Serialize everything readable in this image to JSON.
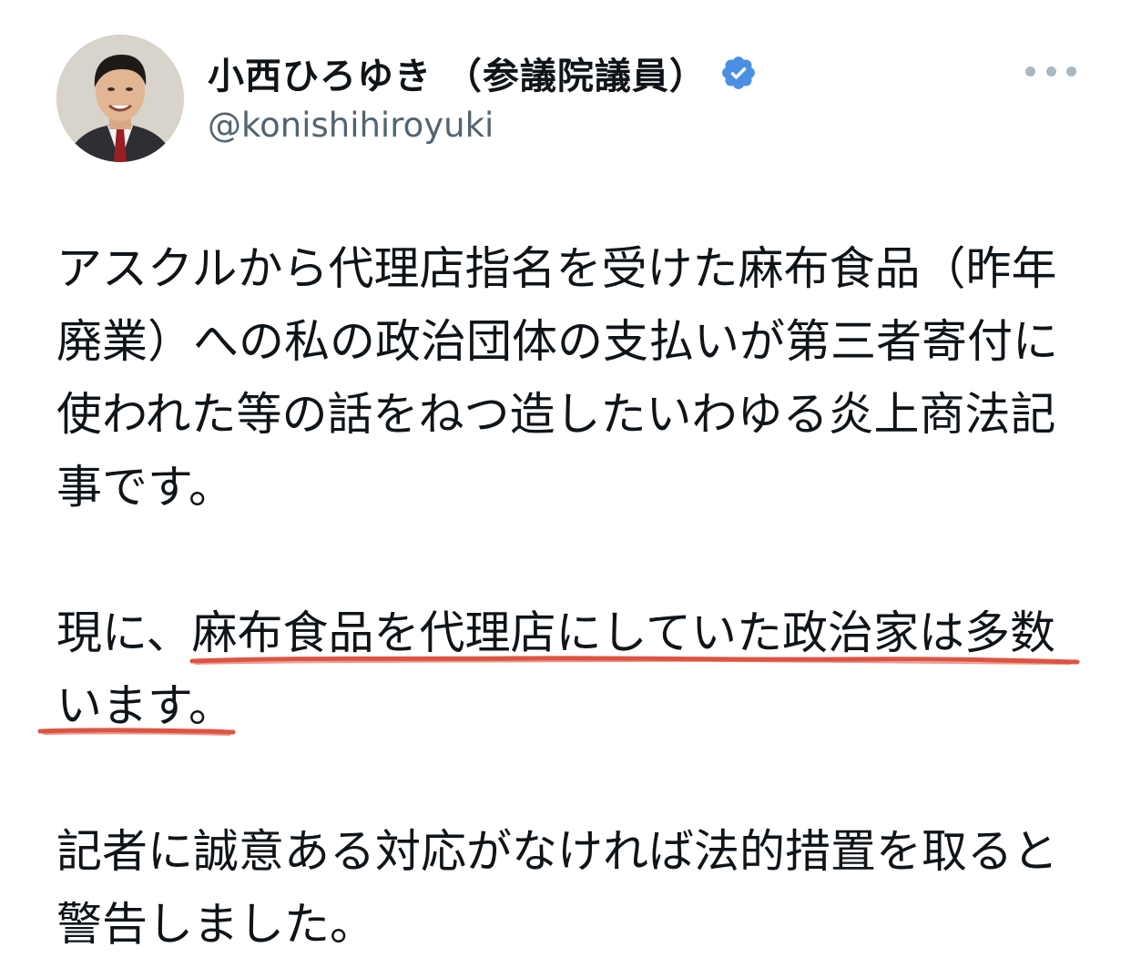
{
  "tweet": {
    "author": {
      "display_name": "小西ひろゆき （参議院議員）",
      "handle": "@konishihiroyuki",
      "verified_icon": "verified-badge-icon",
      "avatar": "avatar"
    },
    "more_icon": "more-dots-icon",
    "paragraph1": {
      "line1": "アスクルから代理店指名を受けた麻布食品（昨年",
      "line2": "廃業）への私の政治団体の支払いが第三者寄付に",
      "line3": "使われた等の話をねつ造したいわゆる炎上商法記",
      "line4": "事です。"
    },
    "paragraph2": {
      "line1_prefix": "現に、",
      "line1_highlight": "麻布食品を代理店にしていた政治家は多数",
      "line2_highlight": "います。"
    },
    "paragraph3": {
      "line1": "記者に誠意ある対応がなければ法的措置を取ると",
      "line2": "警告しました。"
    },
    "colors": {
      "verified_blue": "#4a90e2",
      "handle_gray": "#536471",
      "underline_red": "#d9412e"
    }
  }
}
